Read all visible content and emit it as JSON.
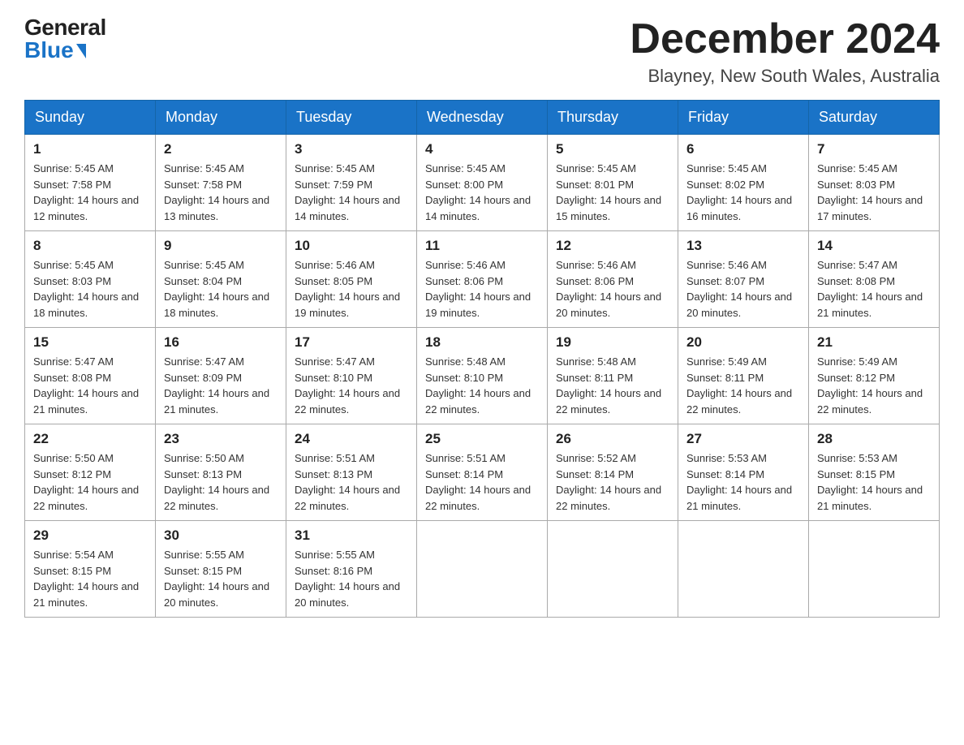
{
  "logo": {
    "general": "General",
    "blue": "Blue"
  },
  "title": {
    "month_year": "December 2024",
    "location": "Blayney, New South Wales, Australia"
  },
  "headers": [
    "Sunday",
    "Monday",
    "Tuesday",
    "Wednesday",
    "Thursday",
    "Friday",
    "Saturday"
  ],
  "weeks": [
    [
      {
        "day": "1",
        "sunrise": "5:45 AM",
        "sunset": "7:58 PM",
        "daylight": "14 hours and 12 minutes."
      },
      {
        "day": "2",
        "sunrise": "5:45 AM",
        "sunset": "7:58 PM",
        "daylight": "14 hours and 13 minutes."
      },
      {
        "day": "3",
        "sunrise": "5:45 AM",
        "sunset": "7:59 PM",
        "daylight": "14 hours and 14 minutes."
      },
      {
        "day": "4",
        "sunrise": "5:45 AM",
        "sunset": "8:00 PM",
        "daylight": "14 hours and 14 minutes."
      },
      {
        "day": "5",
        "sunrise": "5:45 AM",
        "sunset": "8:01 PM",
        "daylight": "14 hours and 15 minutes."
      },
      {
        "day": "6",
        "sunrise": "5:45 AM",
        "sunset": "8:02 PM",
        "daylight": "14 hours and 16 minutes."
      },
      {
        "day": "7",
        "sunrise": "5:45 AM",
        "sunset": "8:03 PM",
        "daylight": "14 hours and 17 minutes."
      }
    ],
    [
      {
        "day": "8",
        "sunrise": "5:45 AM",
        "sunset": "8:03 PM",
        "daylight": "14 hours and 18 minutes."
      },
      {
        "day": "9",
        "sunrise": "5:45 AM",
        "sunset": "8:04 PM",
        "daylight": "14 hours and 18 minutes."
      },
      {
        "day": "10",
        "sunrise": "5:46 AM",
        "sunset": "8:05 PM",
        "daylight": "14 hours and 19 minutes."
      },
      {
        "day": "11",
        "sunrise": "5:46 AM",
        "sunset": "8:06 PM",
        "daylight": "14 hours and 19 minutes."
      },
      {
        "day": "12",
        "sunrise": "5:46 AM",
        "sunset": "8:06 PM",
        "daylight": "14 hours and 20 minutes."
      },
      {
        "day": "13",
        "sunrise": "5:46 AM",
        "sunset": "8:07 PM",
        "daylight": "14 hours and 20 minutes."
      },
      {
        "day": "14",
        "sunrise": "5:47 AM",
        "sunset": "8:08 PM",
        "daylight": "14 hours and 21 minutes."
      }
    ],
    [
      {
        "day": "15",
        "sunrise": "5:47 AM",
        "sunset": "8:08 PM",
        "daylight": "14 hours and 21 minutes."
      },
      {
        "day": "16",
        "sunrise": "5:47 AM",
        "sunset": "8:09 PM",
        "daylight": "14 hours and 21 minutes."
      },
      {
        "day": "17",
        "sunrise": "5:47 AM",
        "sunset": "8:10 PM",
        "daylight": "14 hours and 22 minutes."
      },
      {
        "day": "18",
        "sunrise": "5:48 AM",
        "sunset": "8:10 PM",
        "daylight": "14 hours and 22 minutes."
      },
      {
        "day": "19",
        "sunrise": "5:48 AM",
        "sunset": "8:11 PM",
        "daylight": "14 hours and 22 minutes."
      },
      {
        "day": "20",
        "sunrise": "5:49 AM",
        "sunset": "8:11 PM",
        "daylight": "14 hours and 22 minutes."
      },
      {
        "day": "21",
        "sunrise": "5:49 AM",
        "sunset": "8:12 PM",
        "daylight": "14 hours and 22 minutes."
      }
    ],
    [
      {
        "day": "22",
        "sunrise": "5:50 AM",
        "sunset": "8:12 PM",
        "daylight": "14 hours and 22 minutes."
      },
      {
        "day": "23",
        "sunrise": "5:50 AM",
        "sunset": "8:13 PM",
        "daylight": "14 hours and 22 minutes."
      },
      {
        "day": "24",
        "sunrise": "5:51 AM",
        "sunset": "8:13 PM",
        "daylight": "14 hours and 22 minutes."
      },
      {
        "day": "25",
        "sunrise": "5:51 AM",
        "sunset": "8:14 PM",
        "daylight": "14 hours and 22 minutes."
      },
      {
        "day": "26",
        "sunrise": "5:52 AM",
        "sunset": "8:14 PM",
        "daylight": "14 hours and 22 minutes."
      },
      {
        "day": "27",
        "sunrise": "5:53 AM",
        "sunset": "8:14 PM",
        "daylight": "14 hours and 21 minutes."
      },
      {
        "day": "28",
        "sunrise": "5:53 AM",
        "sunset": "8:15 PM",
        "daylight": "14 hours and 21 minutes."
      }
    ],
    [
      {
        "day": "29",
        "sunrise": "5:54 AM",
        "sunset": "8:15 PM",
        "daylight": "14 hours and 21 minutes."
      },
      {
        "day": "30",
        "sunrise": "5:55 AM",
        "sunset": "8:15 PM",
        "daylight": "14 hours and 20 minutes."
      },
      {
        "day": "31",
        "sunrise": "5:55 AM",
        "sunset": "8:16 PM",
        "daylight": "14 hours and 20 minutes."
      },
      null,
      null,
      null,
      null
    ]
  ]
}
